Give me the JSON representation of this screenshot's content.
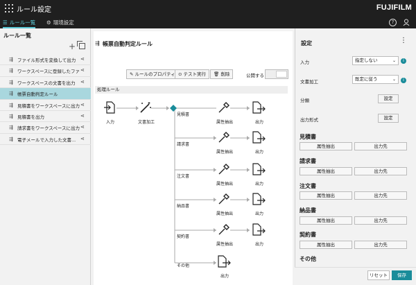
{
  "app": {
    "title": "ルール設定",
    "brand": "FUJIFILM",
    "tabs": [
      {
        "label": "ルール一覧",
        "icon": "list-icon",
        "active": true
      },
      {
        "label": "環境設定",
        "icon": "gear-icon",
        "active": false
      }
    ]
  },
  "sidebar": {
    "title": "ルール一覧",
    "rules": [
      {
        "label": "ファイル形式を変換して出力"
      },
      {
        "label": "ワークスペースに登録したファ..."
      },
      {
        "label": "ワークスペースの文書を出力"
      },
      {
        "label": "帳票自動判定ルール",
        "selected": true
      },
      {
        "label": "見積書をワークスペースに出力"
      },
      {
        "label": "見積書を出力"
      },
      {
        "label": "請求書をワークスペースに出力"
      },
      {
        "label": "電子メールで入力した文書..."
      }
    ]
  },
  "main": {
    "title": "帳票自動判定ルール",
    "toolbar": {
      "properties": "ルールのプロパティ",
      "test_run": "テスト実行",
      "delete": "削除",
      "publish": "公開する"
    },
    "section_label": "処理ルール",
    "flow": {
      "input": "入力",
      "doc_process": "文書加工",
      "extract": "属性抽出",
      "output": "出力",
      "branches": [
        "見積書",
        "請求書",
        "注文書",
        "納品書",
        "契約書",
        "その他"
      ]
    }
  },
  "settings": {
    "title": "設定",
    "input_label": "入力",
    "input_value": "指定しない",
    "doc_label": "文書加工",
    "doc_value": "既定に従う",
    "classify_label": "分類",
    "classify_btn": "設定",
    "output_label": "出力形式",
    "output_btn": "設定",
    "categories": [
      {
        "name": "見積書",
        "extract": "属性抽出",
        "dest": "出力先"
      },
      {
        "name": "請求書",
        "extract": "属性抽出",
        "dest": "出力先"
      },
      {
        "name": "注文書",
        "extract": "属性抽出",
        "dest": "出力先"
      },
      {
        "name": "納品書",
        "extract": "属性抽出",
        "dest": "出力先"
      },
      {
        "name": "契約書",
        "extract": "属性抽出",
        "dest": "出力先"
      },
      {
        "name": "その他"
      }
    ],
    "reset": "リセット",
    "save": "保存"
  }
}
